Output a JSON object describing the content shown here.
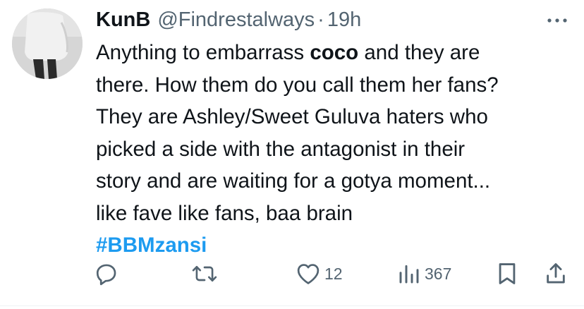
{
  "tweet": {
    "display_name": "KunB",
    "handle": "@Findrestalways",
    "separator": "·",
    "time": "19h",
    "body": {
      "line1_before": "Anything to embarrass ",
      "line1_bold": "coco",
      "line1_after": " and they are",
      "line2": "there. How them do you call them her fans?",
      "line3": "They are Ashley/Sweet Guluva haters who",
      "line4": "picked a side with the antagonist in their",
      "line5": "story and are waiting for a gotya moment...",
      "line6": "like fave like fans, baa brain",
      "hashtag": "#BBMzansi"
    },
    "actions": {
      "reply_icon": "reply-icon",
      "retweet_icon": "retweet-icon",
      "like_icon": "heart-icon",
      "like_count": "12",
      "views_icon": "views-chart-icon",
      "views_count": "367",
      "bookmark_icon": "bookmark-icon",
      "share_icon": "share-icon"
    }
  },
  "colors": {
    "text": "#0f1419",
    "secondary": "#536471",
    "link": "#1d9bf0",
    "background": "#ffffff"
  }
}
